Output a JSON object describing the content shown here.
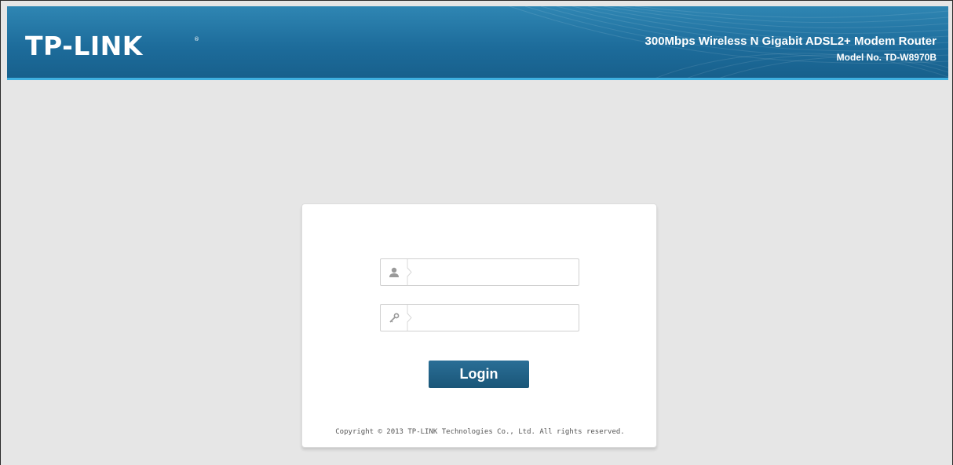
{
  "header": {
    "logo_text": "TP-LINK",
    "logo_registered": "®",
    "product_name": "300Mbps Wireless N Gigabit ADSL2+ Modem Router",
    "model_number": "Model No. TD-W8970B"
  },
  "login": {
    "username_value": "",
    "password_value": "",
    "username_icon": "user-icon",
    "password_icon": "key-icon",
    "login_label": "Login"
  },
  "footer": {
    "copyright": "Copyright © 2013 TP-LINK Technologies Co., Ltd. All rights reserved."
  },
  "colors": {
    "header_blue": "#1d6c9b",
    "accent_line": "#3fb0e0",
    "button_blue": "#1a5678",
    "background": "#e6e6e6"
  }
}
